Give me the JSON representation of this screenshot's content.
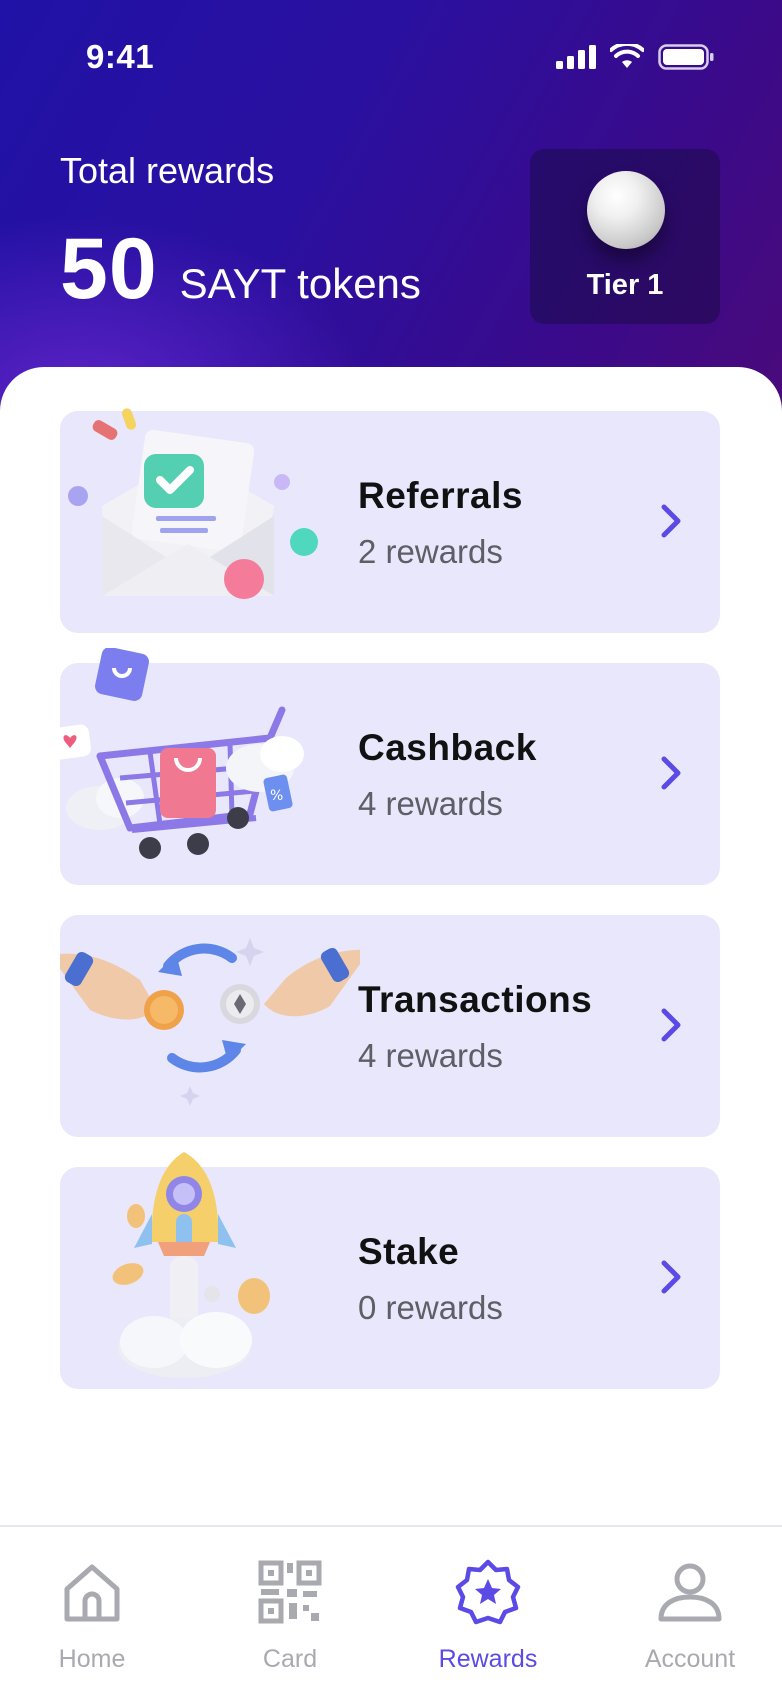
{
  "status_bar": {
    "time": "9:41"
  },
  "summary": {
    "label": "Total rewards",
    "value": "50",
    "unit": "SAYT tokens",
    "tier": "Tier 1"
  },
  "categories": [
    {
      "title": "Referrals",
      "subtitle": "2 rewards",
      "icon": "envelope-check-illustration"
    },
    {
      "title": "Cashback",
      "subtitle": "4 rewards",
      "icon": "shopping-cart-illustration"
    },
    {
      "title": "Transactions",
      "subtitle": "4 rewards",
      "icon": "coin-exchange-illustration"
    },
    {
      "title": "Stake",
      "subtitle": "0 rewards",
      "icon": "rocket-illustration"
    }
  ],
  "tabs": [
    {
      "label": "Home",
      "icon": "home-icon",
      "active": false
    },
    {
      "label": "Card",
      "icon": "qr-code-icon",
      "active": false
    },
    {
      "label": "Rewards",
      "icon": "star-badge-icon",
      "active": true
    },
    {
      "label": "Account",
      "icon": "user-icon",
      "active": false
    }
  ],
  "colors": {
    "accent": "#5b4ae6",
    "card_background": "#e9e7fb",
    "header_start": "#2012a6",
    "header_end": "#4a0a7a"
  }
}
